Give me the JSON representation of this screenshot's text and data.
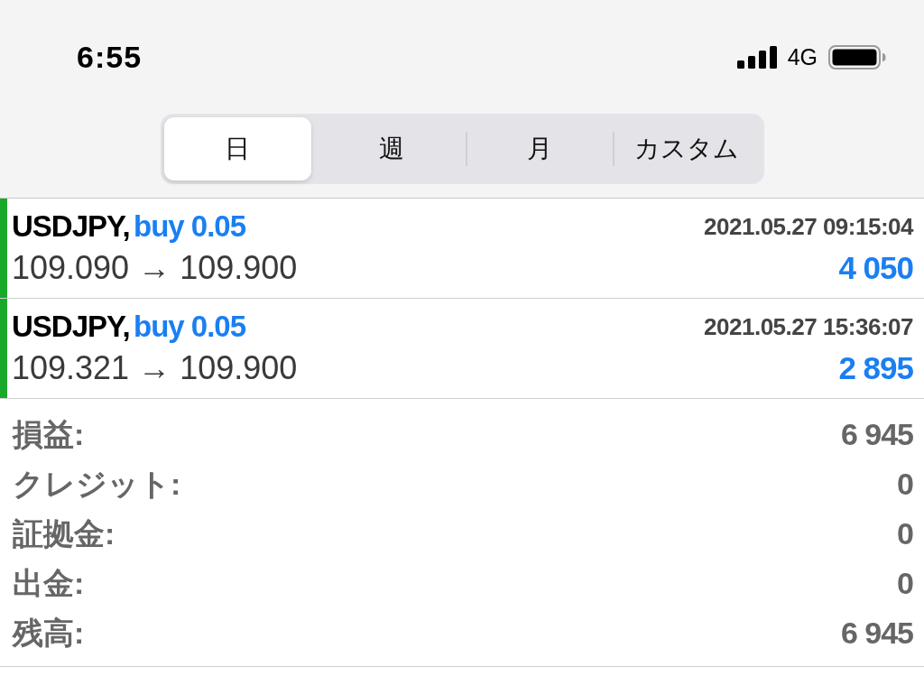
{
  "status_bar": {
    "time": "6:55",
    "network": "4G"
  },
  "period_tabs": [
    {
      "label": "日",
      "selected": true
    },
    {
      "label": "週",
      "selected": false
    },
    {
      "label": "月",
      "selected": false
    },
    {
      "label": "カスタム",
      "selected": false
    }
  ],
  "trades": [
    {
      "symbol": "USDJPY,",
      "order": "buy 0.05",
      "time": "2021.05.27 09:15:04",
      "prices": "109.090 → 109.900",
      "profit": "4 050",
      "color": "#1aa82a"
    },
    {
      "symbol": "USDJPY,",
      "order": "buy 0.05",
      "time": "2021.05.27 15:36:07",
      "prices": "109.321 → 109.900",
      "profit": "2 895",
      "color": "#1aa82a"
    }
  ],
  "summary": [
    {
      "label": "損益:",
      "value": "6 945"
    },
    {
      "label": "クレジット:",
      "value": "0"
    },
    {
      "label": "証拠金:",
      "value": "0"
    },
    {
      "label": "出金:",
      "value": "0"
    },
    {
      "label": "残高:",
      "value": "6 945"
    }
  ]
}
